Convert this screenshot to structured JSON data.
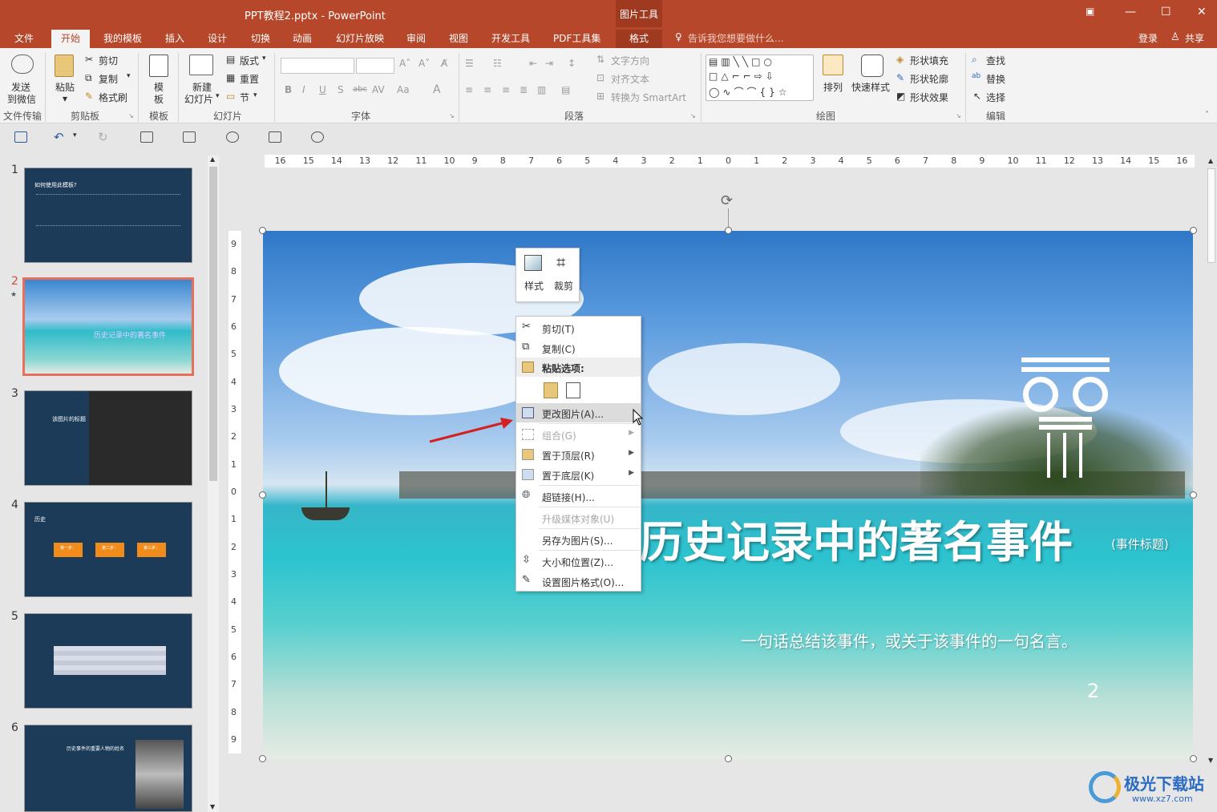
{
  "window": {
    "title": "PPT教程2.pptx - PowerPoint",
    "context_group": "图片工具",
    "min_icon": "minimize-icon",
    "restore_icon": "restore-icon",
    "close_icon": "close-icon"
  },
  "tabs": [
    "文件",
    "开始",
    "我的模板",
    "插入",
    "设计",
    "切换",
    "动画",
    "幻灯片放映",
    "审阅",
    "视图",
    "开发工具",
    "PDF工具集",
    "格式"
  ],
  "active_tab": "开始",
  "tell_me": "告诉我您想要做什么...",
  "login": "登录",
  "share": "共享",
  "ribbon": {
    "send_wechat": "发送\n到微信",
    "send_wechat_line1": "发送",
    "send_wechat_line2": "到微信",
    "group_file_transfer": "文件传输",
    "paste": "粘贴",
    "cut": "剪切",
    "copy": "复制",
    "format_painter": "格式刷",
    "group_clipboard": "剪贴板",
    "template_line1": "模",
    "template_line2": "板",
    "group_template": "模板",
    "new_slide_line1": "新建",
    "new_slide_line2": "幻灯片",
    "layout": "版式",
    "reset": "重置",
    "section": "节",
    "group_slides": "幻灯片",
    "group_font": "字体",
    "text_direction": "文字方向",
    "align_text": "对齐文本",
    "convert_smartart": "转换为 SmartArt",
    "group_paragraph": "段落",
    "arrange": "排列",
    "quick_styles": "快速样式",
    "shape_fill": "形状填充",
    "shape_outline": "形状轮廓",
    "shape_effects": "形状效果",
    "group_drawing": "绘图",
    "find": "查找",
    "replace": "替换",
    "select": "选择",
    "group_editing": "编辑",
    "font_buttons": [
      "B",
      "I",
      "U",
      "S",
      "abc",
      "AV",
      "Aa",
      "A"
    ]
  },
  "slides": [
    {
      "num": "1",
      "title": "如何使用此模板?"
    },
    {
      "num": "2",
      "star": "★",
      "title": "历史记录中的著名事件"
    },
    {
      "num": "3",
      "title": "该图片的标题"
    },
    {
      "num": "4",
      "title": "历史",
      "steps": [
        "第一步：",
        "第二步：",
        "第三步："
      ]
    },
    {
      "num": "5"
    },
    {
      "num": "6",
      "title": "历史事件的重要人物的姓名"
    }
  ],
  "hruler": [
    "16",
    "15",
    "14",
    "13",
    "12",
    "11",
    "10",
    "9",
    "8",
    "7",
    "6",
    "5",
    "4",
    "3",
    "2",
    "1",
    "0",
    "1",
    "2",
    "3",
    "4",
    "5",
    "6",
    "7",
    "8",
    "9",
    "10",
    "11",
    "12",
    "13",
    "14",
    "15",
    "16"
  ],
  "vruler": [
    "9",
    "8",
    "7",
    "6",
    "5",
    "4",
    "3",
    "2",
    "1",
    "0",
    "1",
    "2",
    "3",
    "4",
    "5",
    "6",
    "7",
    "8",
    "9"
  ],
  "main_slide": {
    "title": "历史记录中的著名事件",
    "title_note": "(事件标题)",
    "subtitle": "一句话总结该事件，或关于该事件的一句名言。",
    "page_number": "2"
  },
  "mini_toolbar": {
    "style": "样式",
    "crop": "裁剪"
  },
  "context_menu": [
    {
      "label": "剪切(T)",
      "icon": "scissors-icon",
      "enabled": true
    },
    {
      "label": "复制(C)",
      "icon": "copy-icon",
      "enabled": true
    },
    {
      "label": "粘贴选项:",
      "icon": "paste-icon",
      "enabled": true,
      "header": true
    },
    {
      "label": "更改图片(A)...",
      "icon": "change-picture-icon",
      "enabled": true,
      "highlighted": true
    },
    {
      "label": "组合(G)",
      "icon": "group-icon",
      "enabled": false,
      "submenu": true
    },
    {
      "label": "置于顶层(R)",
      "icon": "bring-front-icon",
      "enabled": true,
      "submenu": true
    },
    {
      "label": "置于底层(K)",
      "icon": "send-back-icon",
      "enabled": true,
      "submenu": true
    },
    {
      "label": "超链接(H)...",
      "icon": "hyperlink-icon",
      "enabled": true
    },
    {
      "label": "升级媒体对象(U)",
      "enabled": false
    },
    {
      "label": "另存为图片(S)...",
      "enabled": true
    },
    {
      "label": "大小和位置(Z)...",
      "icon": "size-position-icon",
      "enabled": true
    },
    {
      "label": "设置图片格式(O)...",
      "icon": "format-picture-icon",
      "enabled": true
    }
  ],
  "watermark": {
    "text": "极光下载站",
    "url": "www.xz7.com"
  },
  "colors": {
    "accent": "#b7472a",
    "selected_thumb": "#e8705a",
    "arrow": "#d42020"
  }
}
